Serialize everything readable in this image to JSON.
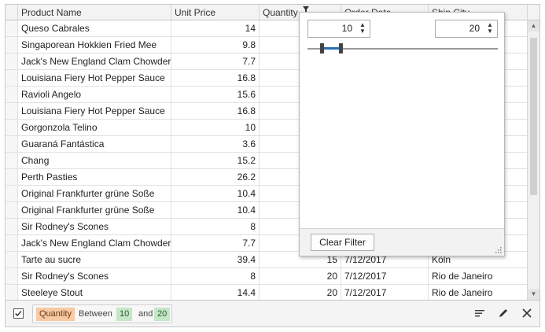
{
  "columns": [
    "Product Name",
    "Unit Price",
    "Quantity",
    "Order Date",
    "Ship City"
  ],
  "rows": [
    [
      "Queso Cabrales",
      "14",
      "",
      "",
      ""
    ],
    [
      "Singaporean Hokkien Fried Mee",
      "9.8",
      "",
      "",
      ""
    ],
    [
      "Jack's New England Clam Chowder",
      "7.7",
      "",
      "",
      ""
    ],
    [
      "Louisiana Fiery Hot Pepper Sauce",
      "16.8",
      "",
      "",
      ""
    ],
    [
      "Ravioli Angelo",
      "15.6",
      "",
      "",
      ""
    ],
    [
      "Louisiana Fiery Hot Pepper Sauce",
      "16.8",
      "",
      "",
      ""
    ],
    [
      "Gorgonzola Telino",
      "10",
      "",
      "",
      ""
    ],
    [
      "Guaraná Fantástica",
      "3.6",
      "",
      "",
      ""
    ],
    [
      "Chang",
      "15.2",
      "",
      "",
      ""
    ],
    [
      "Perth Pasties",
      "26.2",
      "",
      "",
      ""
    ],
    [
      "Original Frankfurter grüne Soße",
      "10.4",
      "",
      "",
      ""
    ],
    [
      "Original Frankfurter grüne Soße",
      "10.4",
      "",
      "",
      ""
    ],
    [
      "Sir Rodney's Scones",
      "8",
      "",
      "",
      ""
    ],
    [
      "Jack's New England Clam Chowder",
      "7.7",
      "",
      "",
      ""
    ],
    [
      "Tarte au sucre",
      "39.4",
      "15",
      "7/12/2017",
      "Köln"
    ],
    [
      "Sir Rodney's Scones",
      "8",
      "20",
      "7/12/2017",
      "Rio de Janeiro"
    ],
    [
      "Steeleye Stout",
      "14.4",
      "20",
      "7/12/2017",
      "Rio de Janeiro"
    ]
  ],
  "filter_popup": {
    "from_value": "10",
    "to_value": "20",
    "clear_label": "Clear Filter"
  },
  "filter_panel": {
    "enabled": true,
    "field": "Quantity",
    "operator": "Between",
    "value1": "10",
    "conjunction": "and",
    "value2": "20"
  },
  "icons": {
    "filter": "filter-icon",
    "checkbox": "check-icon",
    "customize": "filter-editor-icon",
    "edit": "pencil-icon",
    "close": "close-icon",
    "scroll_up": "chevron-up-icon",
    "scroll_down": "chevron-down-icon",
    "resize": "resize-grip-icon"
  },
  "colors": {
    "field_token": "#f7c9a4",
    "value_token": "#c5e6c7",
    "slider_range": "#2b6cb5"
  }
}
